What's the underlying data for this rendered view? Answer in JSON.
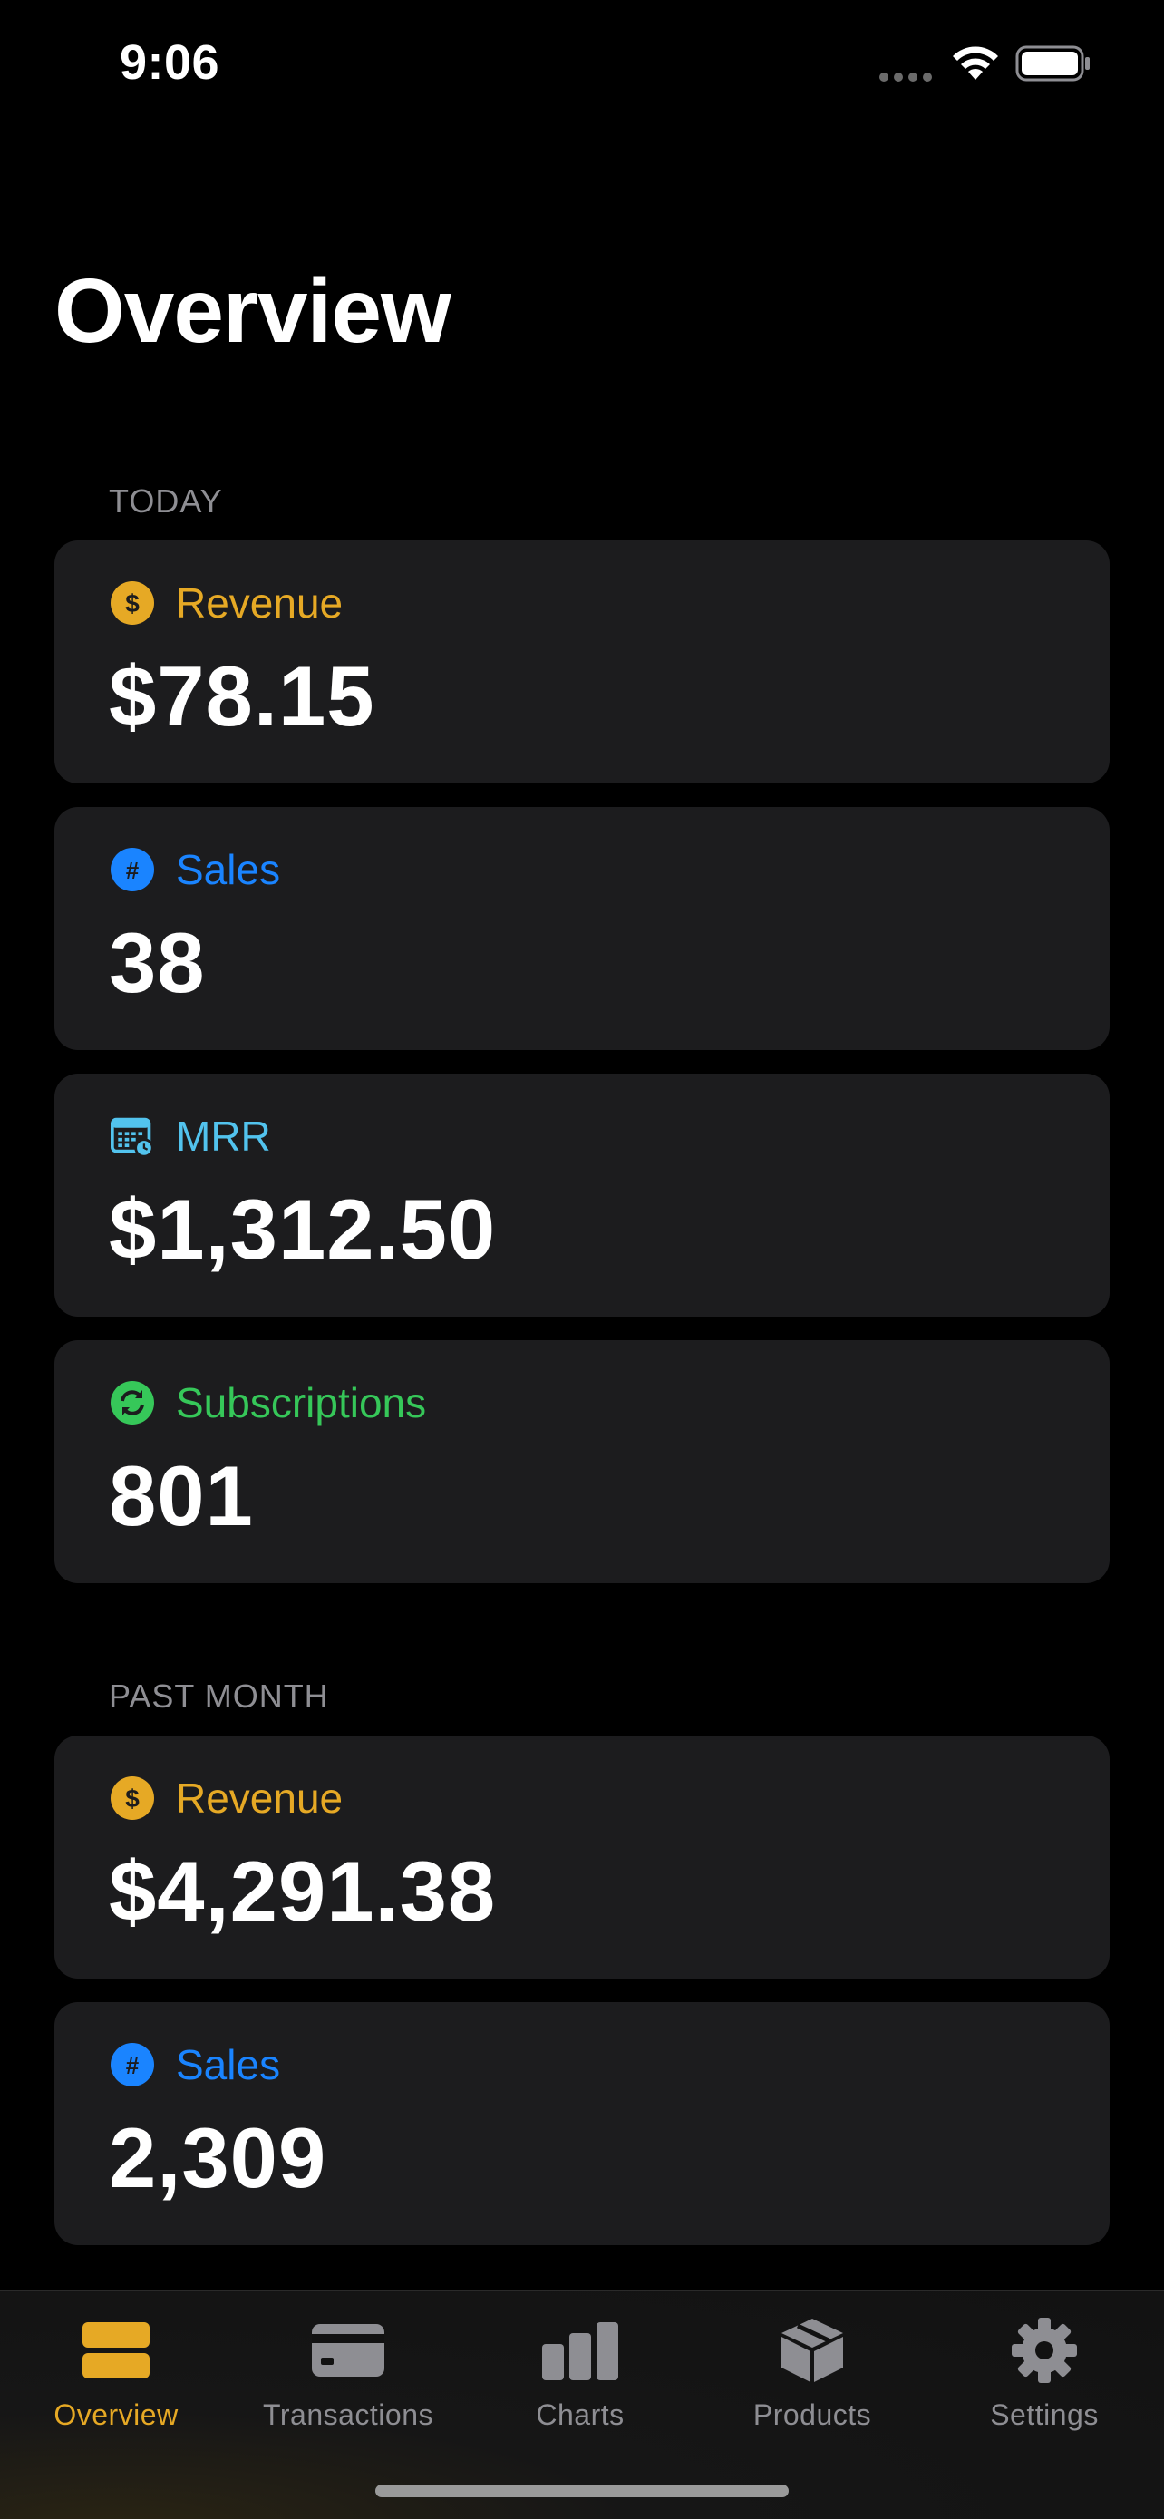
{
  "status_bar": {
    "time": "9:06"
  },
  "page": {
    "title": "Overview"
  },
  "sections": {
    "today": {
      "header": "TODAY",
      "cards": {
        "revenue": {
          "label": "Revenue",
          "value": "$78.15",
          "icon": "dollar-circle-icon",
          "color": "#e6a925"
        },
        "sales": {
          "label": "Sales",
          "value": "38",
          "icon": "hash-circle-icon",
          "color": "#1a84ff"
        },
        "mrr": {
          "label": "MRR",
          "value": "$1,312.50",
          "icon": "calendar-clock-icon",
          "color": "#52c3ee"
        },
        "subscriptions": {
          "label": "Subscriptions",
          "value": "801",
          "icon": "refresh-circle-icon",
          "color": "#36c759"
        }
      }
    },
    "past_month": {
      "header": "PAST MONTH",
      "cards": {
        "revenue": {
          "label": "Revenue",
          "value": "$4,291.38",
          "icon": "dollar-circle-icon",
          "color": "#e6a925"
        },
        "sales": {
          "label": "Sales",
          "value": "2,309",
          "icon": "hash-circle-icon",
          "color": "#1a84ff"
        }
      }
    }
  },
  "tab_bar": {
    "active": "Overview",
    "active_color": "#e6a925",
    "tabs": [
      {
        "label": "Overview",
        "icon": "overview-icon"
      },
      {
        "label": "Transactions",
        "icon": "credit-card-icon"
      },
      {
        "label": "Charts",
        "icon": "bar-chart-icon"
      },
      {
        "label": "Products",
        "icon": "box-icon"
      },
      {
        "label": "Settings",
        "icon": "gear-icon"
      }
    ]
  }
}
